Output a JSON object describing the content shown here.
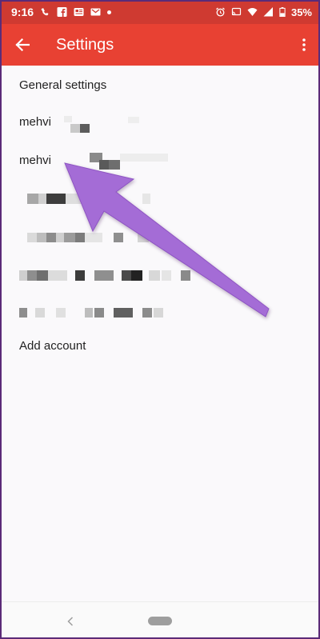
{
  "status_bar": {
    "time": "9:16",
    "battery_percent": "35%",
    "left_icons": [
      "missed-call-icon",
      "facebook-icon",
      "news-icon",
      "gmail-icon",
      "notification-dot-icon"
    ],
    "right_icons": [
      "alarm-icon",
      "cast-icon",
      "wifi-icon",
      "signal-icon",
      "battery-icon"
    ]
  },
  "app_bar": {
    "title": "Settings",
    "back_icon": "arrow-back-icon",
    "overflow_icon": "more-vert-icon",
    "color": "#e84133"
  },
  "settings_list": {
    "general": "General settings",
    "account_1_name": "mehvi",
    "account_2_name": "mehvi",
    "add_account": "Add account"
  },
  "annotation": {
    "arrow_color": "#a46cd6"
  }
}
